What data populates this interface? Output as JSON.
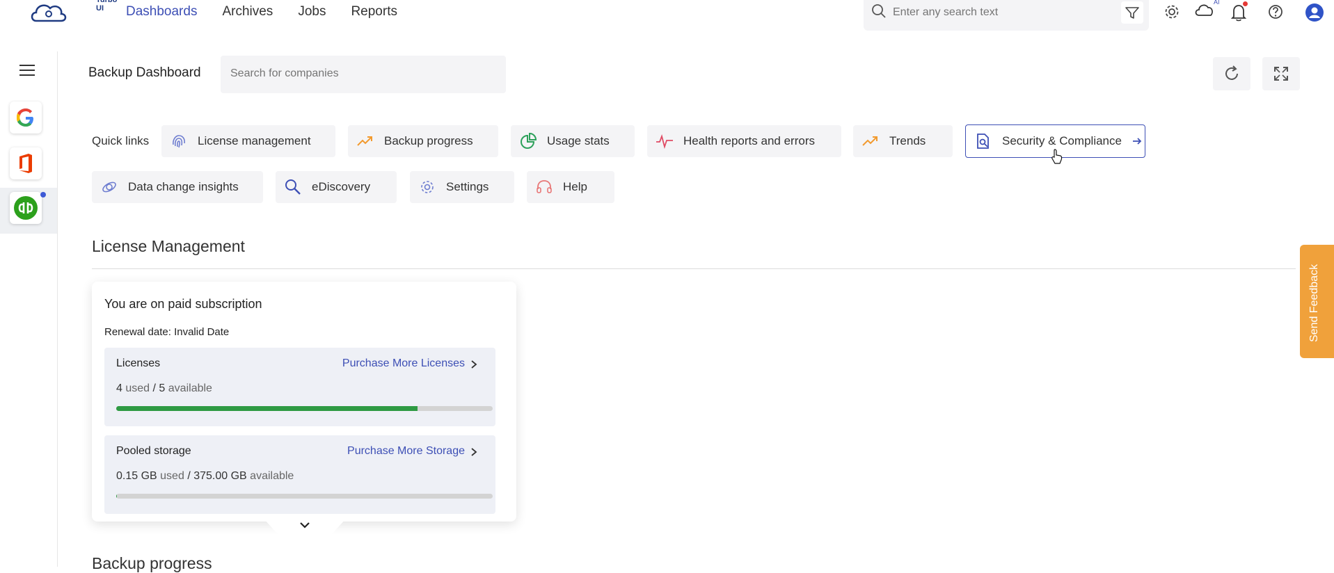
{
  "topnav": {
    "logo_text": "Turbo UI",
    "items": [
      {
        "label": "Dashboards",
        "active": true
      },
      {
        "label": "Archives"
      },
      {
        "label": "Jobs"
      },
      {
        "label": "Reports"
      }
    ],
    "search_placeholder": "Enter any search text",
    "ai_badge": "AI"
  },
  "sidebar": {
    "apps": [
      "google-icon",
      "office-icon",
      "quickbooks-icon"
    ]
  },
  "page": {
    "title": "Backup Dashboard",
    "company_search_placeholder": "Search for companies"
  },
  "quick_links": {
    "label": "Quick links",
    "items": [
      {
        "label": "License management"
      },
      {
        "label": "Backup progress"
      },
      {
        "label": "Usage stats"
      },
      {
        "label": "Health reports and errors"
      },
      {
        "label": "Trends"
      },
      {
        "label": "Security & Compliance"
      },
      {
        "label": "Data change insights"
      },
      {
        "label": "eDiscovery"
      },
      {
        "label": "Settings"
      },
      {
        "label": "Help"
      }
    ]
  },
  "license": {
    "section_title": "License Management",
    "card_heading": "You are on paid subscription",
    "renewal": "Renewal date: Invalid Date",
    "licenses": {
      "title": "Licenses",
      "link": "Purchase More Licenses",
      "used": "4",
      "used_word": "used",
      "sep": "/",
      "total": "5",
      "avail_word": "available",
      "fraction": 0.8
    },
    "storage": {
      "title": "Pooled storage",
      "link": "Purchase More Storage",
      "used": "0.15 GB",
      "used_word": "used",
      "sep": "/",
      "total": "375.00 GB",
      "avail_word": "available",
      "fraction": 0.0004
    }
  },
  "next_section": {
    "title": "Backup progress"
  },
  "feedback": {
    "label": "Send Feedback"
  },
  "colors": {
    "accent": "#3d4fb5",
    "bar_fill": "#2e9a43",
    "feedback": "#f0a13b"
  }
}
